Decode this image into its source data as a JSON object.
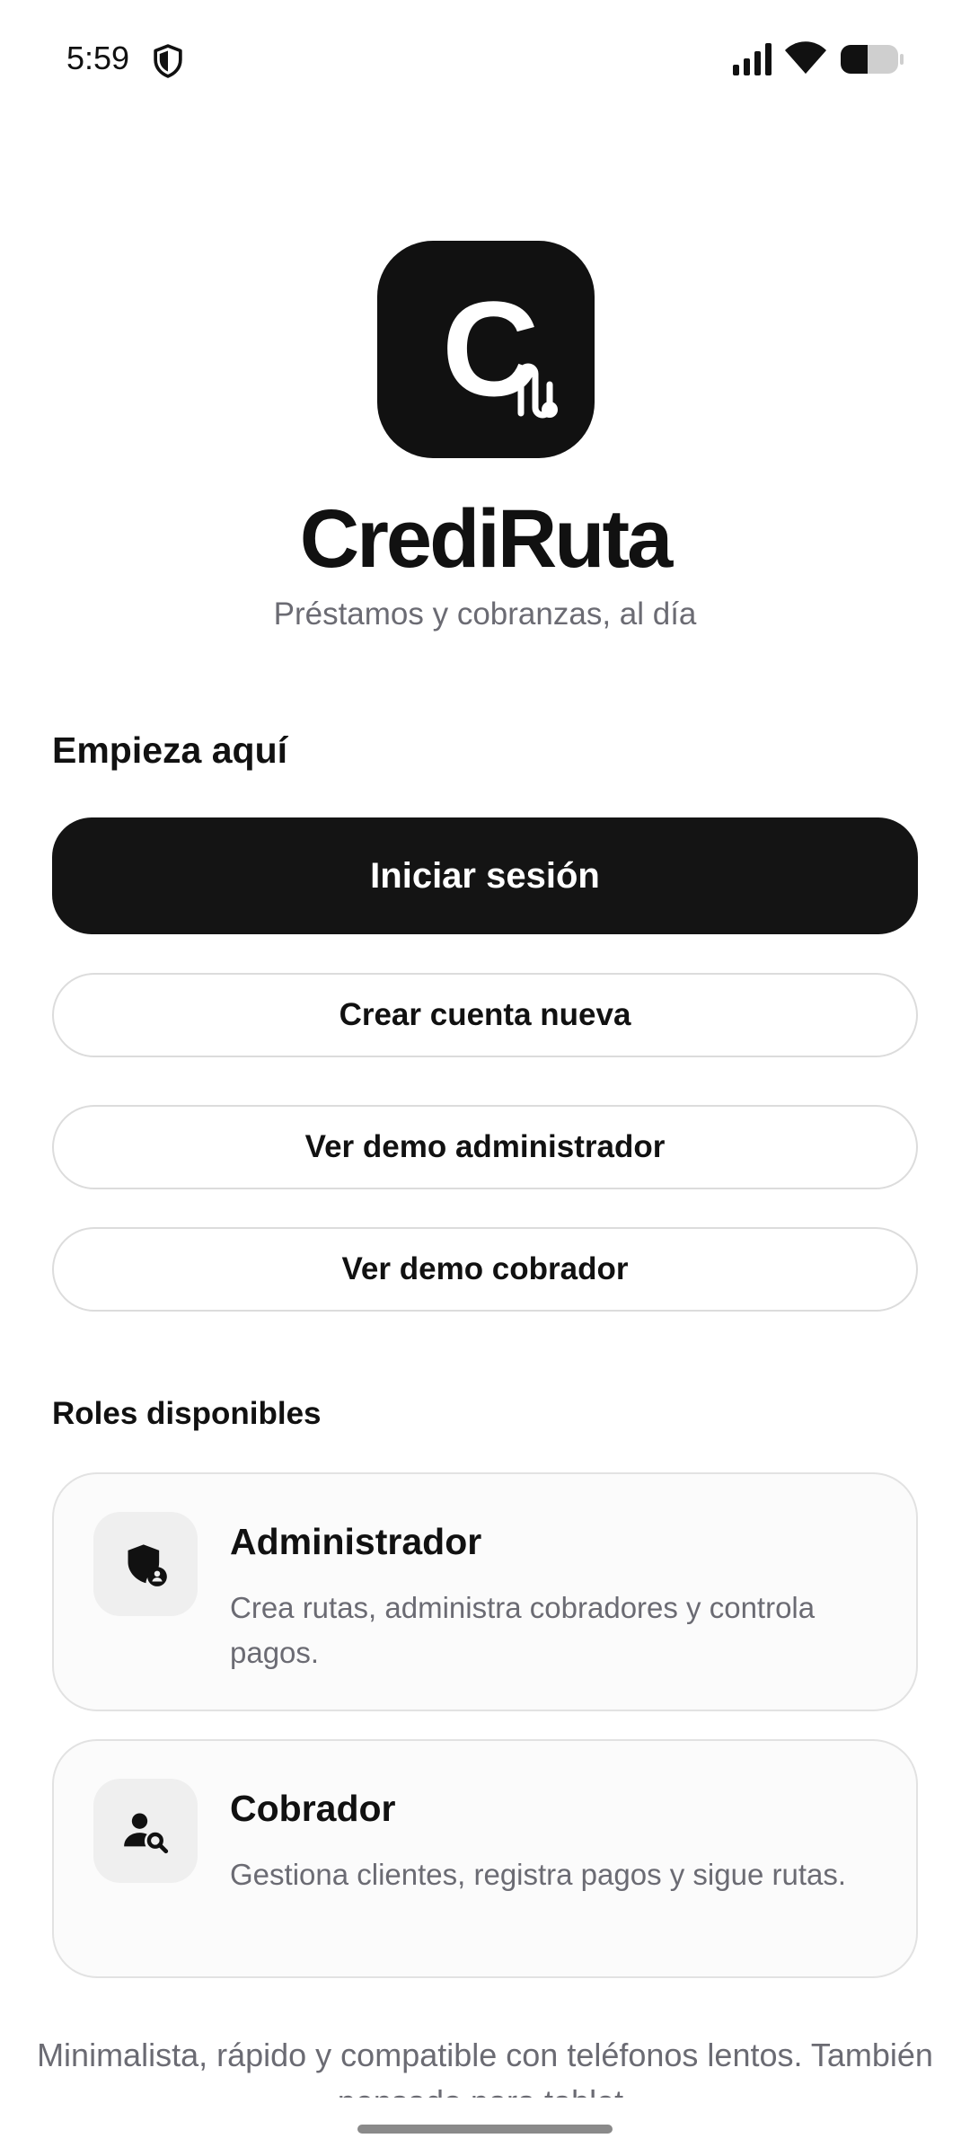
{
  "status_bar": {
    "time": "5:59",
    "icons": [
      "shield-icon",
      "signal-icon",
      "wifi-icon",
      "battery-icon"
    ]
  },
  "app": {
    "logo_letter": "C",
    "name": "CrediRuta",
    "tagline": "Préstamos y cobranzas, al día"
  },
  "start_section": {
    "title": "Empieza aquí",
    "login_label": "Iniciar sesión",
    "create_account_label": "Crear cuenta nueva",
    "demo_admin_label": "Ver demo administrador",
    "demo_collector_label": "Ver demo cobrador"
  },
  "roles_section": {
    "title": "Roles disponibles",
    "roles": [
      {
        "icon": "admin-shield-icon",
        "title": "Administrador",
        "description": "Crea rutas, administra cobradores y controla pagos."
      },
      {
        "icon": "person-search-icon",
        "title": "Cobrador",
        "description": "Gestiona clientes, registra pagos y sigue rutas."
      }
    ]
  },
  "footer": {
    "note": "Minimalista, rápido y compatible con teléfonos lentos. También pensado para tablet."
  },
  "colors": {
    "primary": "#141414",
    "text": "#111111",
    "muted_text": "#6b6b73",
    "card_background": "#fbfbfb",
    "border": "#dcdcdc"
  }
}
